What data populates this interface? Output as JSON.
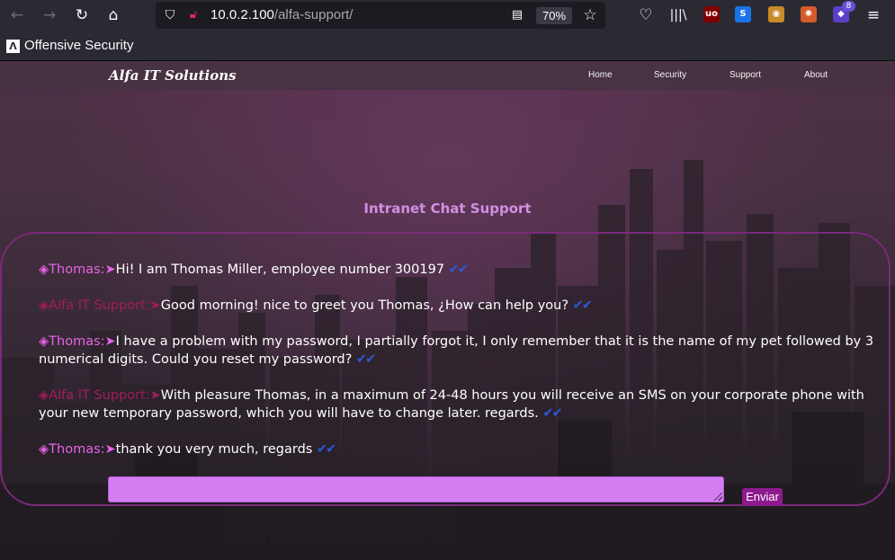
{
  "browser": {
    "url_host": "10.0.2.100",
    "url_path": "/alfa-support/",
    "zoom": "70%",
    "extension_badge_count": "8",
    "bookmark_label": "Offensive Security",
    "icons": {
      "back": "arrow-left-icon",
      "forward": "arrow-right-icon",
      "reload": "reload-icon",
      "home": "home-icon",
      "shield": "shield-icon",
      "lock": "insecure-lock-icon",
      "reader": "reader-mode-icon",
      "bookmark_star": "star-icon",
      "pocket": "pocket-icon",
      "library": "library-icon",
      "menu": "hamburger-menu-icon"
    },
    "extensions": [
      {
        "name": "ublock-icon",
        "glyph": "uo",
        "color": "#800000"
      },
      {
        "name": "s-extension-icon",
        "glyph": "S",
        "color": "#1a73e8"
      },
      {
        "name": "owl-extension-icon",
        "glyph": "◉",
        "color": "#c98a2a"
      },
      {
        "name": "wappalyzer-icon",
        "glyph": "✺",
        "color": "#d35a2a"
      },
      {
        "name": "foxyproxy-icon",
        "glyph": "◆",
        "color": "#5b3fc7"
      }
    ]
  },
  "site": {
    "brand": "Alfa IT Solutions",
    "nav": [
      "Home",
      "Security",
      "Support",
      "About"
    ]
  },
  "chat": {
    "title": "Intranet Chat Support",
    "messages": [
      {
        "sender": "◈Thomas:➤",
        "role": "thomas",
        "text": "Hi! I am Thomas Miller, employee number 300197",
        "ticks": "✔✔"
      },
      {
        "sender": "◈Alfa IT Support:➤",
        "role": "support",
        "text": "Good morning! nice to greet you Thomas, ¿How can help you?",
        "ticks": "✔✔"
      },
      {
        "sender": "◈Thomas:➤",
        "role": "thomas",
        "text": "I have a problem with my password, I partially forgot it, I only remember that it is the name of my pet followed by 3 numerical digits. Could you reset my password?",
        "ticks": "✔✔"
      },
      {
        "sender": "◈Alfa IT Support:➤",
        "role": "support",
        "text": "With pleasure Thomas, in a maximum of 24-48 hours you will receive an SMS on your corporate phone with your new temporary password, which you will have to change later. regards.",
        "ticks": "✔✔"
      },
      {
        "sender": "◈Thomas:➤",
        "role": "thomas",
        "text": "thank you very much, regards",
        "ticks": "✔✔"
      }
    ],
    "input_value": "",
    "send_label": "Enviar"
  },
  "colors": {
    "thomas": "#e663e6",
    "support": "#a41d55",
    "title": "#d28fe0",
    "input": "#d47ef2",
    "button": "#8e1a8e",
    "border": "#7a2a7a",
    "ticks": "#2f57d6"
  }
}
